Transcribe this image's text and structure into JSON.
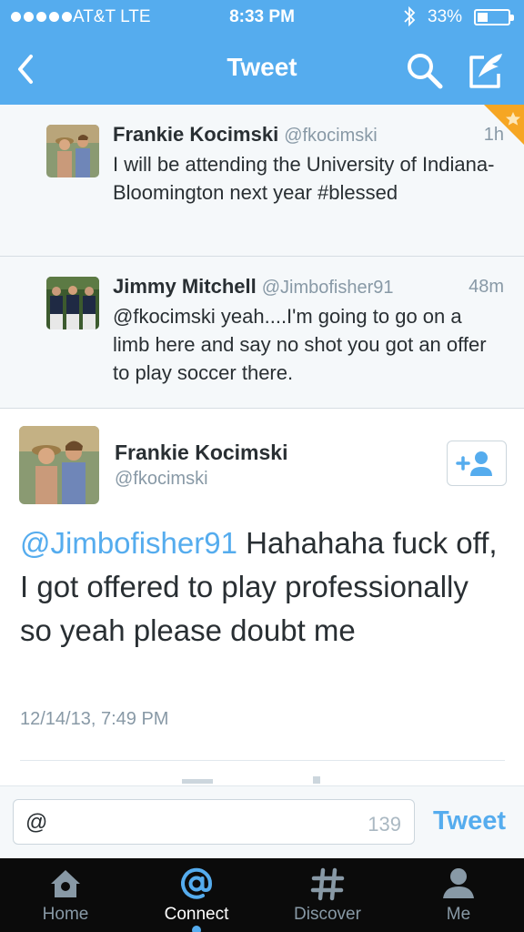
{
  "status_bar": {
    "carrier": "AT&T  LTE",
    "time": "8:33 PM",
    "battery_percent": "33%",
    "battery_level": 0.33,
    "bluetooth_icon": "bluetooth-icon"
  },
  "nav": {
    "title": "Tweet",
    "back_icon": "chevron-left-icon",
    "search_icon": "search-icon",
    "compose_icon": "compose-icon"
  },
  "conversation": [
    {
      "name": "Frankie Kocimski",
      "handle": "@fkocimski",
      "time": "1h",
      "text": "I will be attending the University of Indiana-Bloomington next year #blessed"
    },
    {
      "name": "Jimmy Mitchell",
      "handle": "@Jimbofisher91",
      "time": "48m",
      "text": "@fkocimski yeah....I'm going to go on a limb here and say no shot you got an offer to play soccer there."
    }
  ],
  "focused_tweet": {
    "name": "Frankie Kocimski",
    "handle": "@fkocimski",
    "mention": "@Jimbofisher91",
    "text": " Hahahaha fuck off, I got offered to play professionally so yeah please doubt me",
    "date": "12/14/13, 7:49 PM",
    "follow_icon": "add-user-icon"
  },
  "reply": {
    "value": "@",
    "char_count": "139",
    "send_label": "Tweet"
  },
  "tabs": [
    {
      "label": "Home",
      "icon": "home-icon"
    },
    {
      "label": "Connect",
      "icon": "at-icon",
      "active": true
    },
    {
      "label": "Discover",
      "icon": "hashtag-icon"
    },
    {
      "label": "Me",
      "icon": "person-icon"
    }
  ],
  "colors": {
    "brand": "#55acee",
    "tab_bar": "#0b0b0b",
    "secondary_text": "#8899a6"
  }
}
